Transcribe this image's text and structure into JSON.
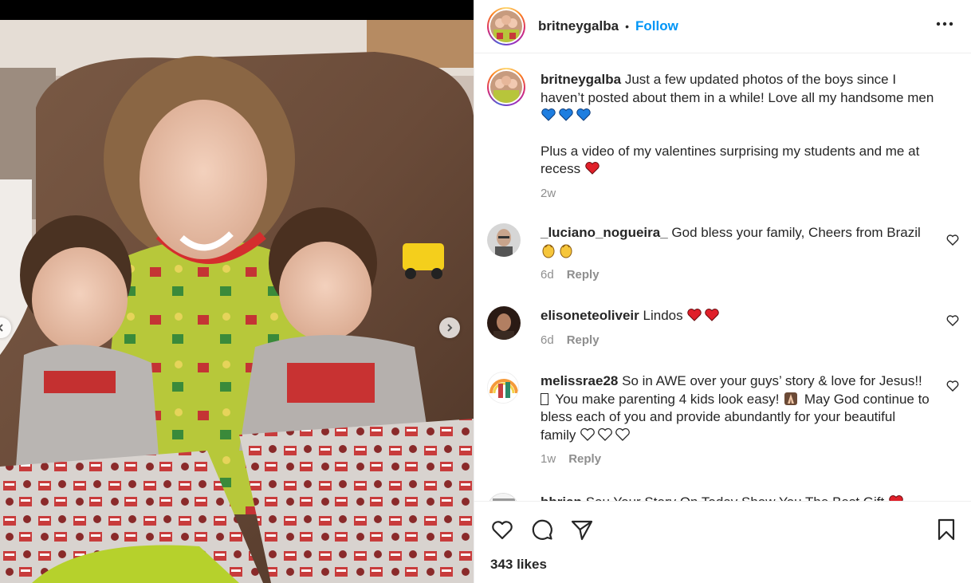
{
  "post": {
    "username": "britneygalba",
    "follow_label": "Follow",
    "dot": "•"
  },
  "caption": {
    "username": "britneygalba",
    "text_line1": "Just a few updated photos of the boys since I haven’t posted about them in a while! Love all my handsome men",
    "text_line2": "Plus a video of my valentines surprising my students and me at recess",
    "time": "2w"
  },
  "comments": [
    {
      "username": "_luciano_nogueira_",
      "text": "God bless your family, Cheers from Brazil",
      "time": "6d",
      "reply": "Reply"
    },
    {
      "username": "elisoneteoliveir",
      "text": "Lindos",
      "time": "6d",
      "reply": "Reply"
    },
    {
      "username": "melissrae28",
      "text_a": "So in AWE over your guys’ story & love for Jesus!! ",
      "text_b": "You make parenting 4 kids look easy!",
      "text_c": " May God continue to bless each of you and provide abundantly for your beautiful family",
      "time": "1w",
      "reply": "Reply"
    },
    {
      "username": "bbrian",
      "text": "Sou Your Story On Today Show You The Best Gift"
    }
  ],
  "actions": {
    "likes": "343 likes"
  },
  "icons": {
    "like": "heart-outline-icon",
    "comment": "comment-bubble-icon",
    "share": "paper-plane-icon",
    "save": "bookmark-icon",
    "more": "more-horizontal-icon",
    "prev": "chevron-left-icon",
    "next": "chevron-right-icon"
  },
  "colors": {
    "follow_blue": "#0095f6",
    "text": "#262626",
    "muted": "#8e8e8e",
    "heart_red": "#e0202a",
    "blue_heart": "#1e7ee0"
  }
}
